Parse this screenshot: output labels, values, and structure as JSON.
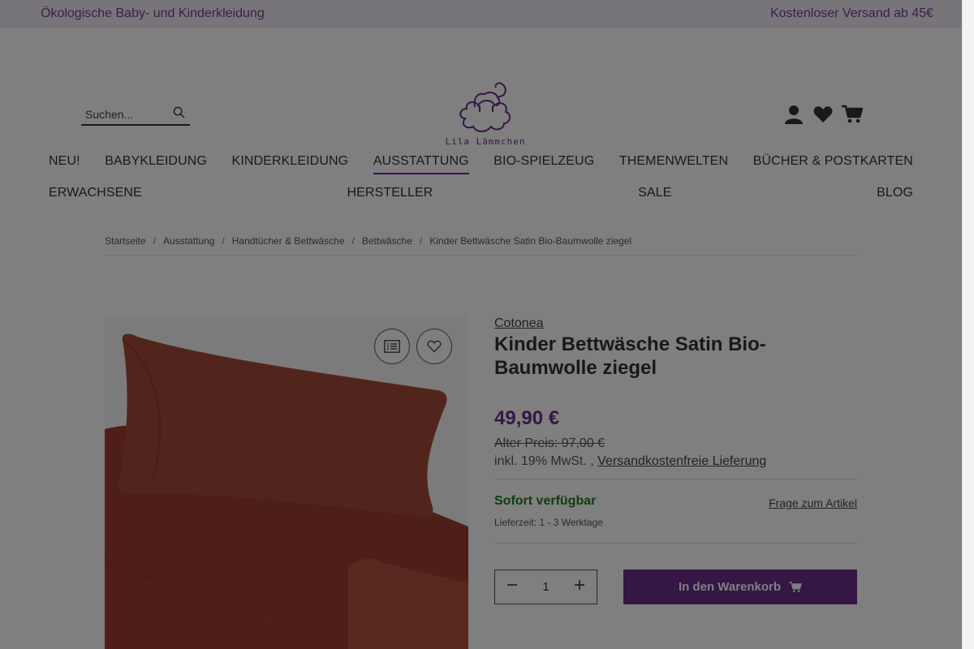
{
  "topbar": {
    "left": "Ökologische Baby- und Kinderkleidung",
    "right": "Kostenloser Versand ab 45€"
  },
  "search": {
    "placeholder": "Suchen...",
    "icon": "search-icon"
  },
  "logo": {
    "text": "Lila Lämmchen"
  },
  "header_icons": [
    "user-icon",
    "heart-icon",
    "cart-icon"
  ],
  "nav": {
    "row1": [
      "NEU!",
      "BABYKLEIDUNG",
      "KINDERKLEIDUNG",
      "AUSSTATTUNG",
      "BIO-SPIELZEUG",
      "THEMENWELTEN",
      "BÜCHER & POSTKARTEN"
    ],
    "row2": [
      "ERWACHSENE",
      "HERSTELLER",
      "SALE",
      "BLOG"
    ],
    "active": "AUSSTATTUNG"
  },
  "breadcrumb": [
    "Startseite",
    "Ausstattung",
    "Handtücher & Bettwäsche",
    "Bettwäsche",
    "Kinder Bettwäsche Satin Bio-Baumwolle ziegel"
  ],
  "product": {
    "manufacturer": "Cotonea",
    "title": "Kinder Bettwäsche Satin Bio-Baumwolle ziegel",
    "price": "49,90 €",
    "old_price": "Alter Preis: 97,00 €",
    "tax_prefix": "inkl. 19% MwSt. ,",
    "shipping_link": "Versandkostenfreie Lieferung",
    "availability": "Sofort verfügbar",
    "delivery": "Lieferzeit: 1 - 3 Werktage",
    "question_link": "Frage zum Artikel",
    "quantity": "1",
    "cart_button": "In den Warenkorb"
  },
  "colors": {
    "accent": "#6b2d8a",
    "available": "#1e7d1e",
    "product": "#a54a38"
  }
}
